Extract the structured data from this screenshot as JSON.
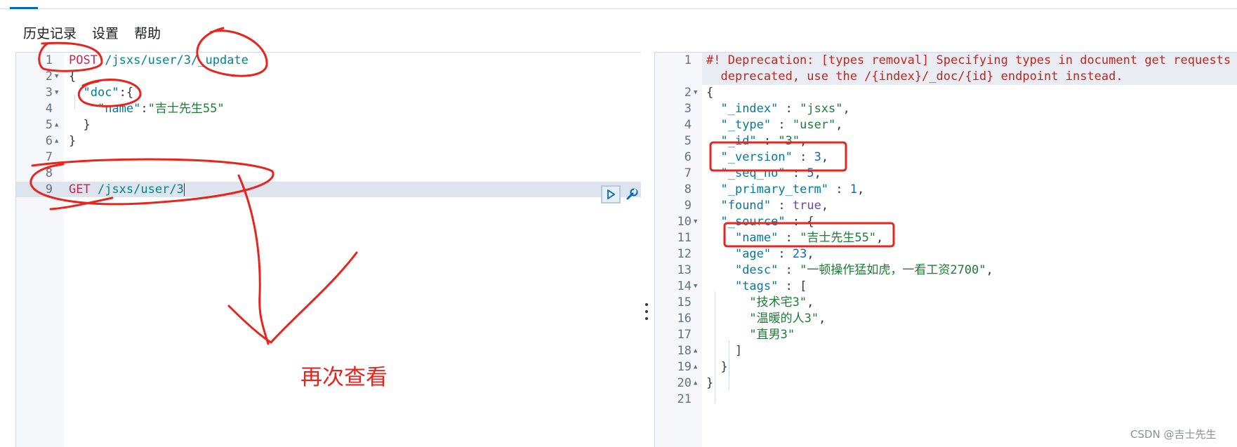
{
  "menu": {
    "history": "历史记录",
    "settings": "设置",
    "help": "帮助"
  },
  "request": {
    "lines": [
      {
        "n": "1",
        "fold": "",
        "parts": [
          [
            "method",
            "POST"
          ],
          [
            "punc",
            " "
          ],
          [
            "url",
            "/jsxs/user/3/_update"
          ]
        ]
      },
      {
        "n": "2",
        "fold": "down",
        "parts": [
          [
            "punc",
            "{"
          ]
        ]
      },
      {
        "n": "3",
        "fold": "down",
        "parts": [
          [
            "punc",
            "  "
          ],
          [
            "key",
            "\"doc\""
          ],
          [
            "punc",
            ":{"
          ]
        ]
      },
      {
        "n": "4",
        "fold": "",
        "parts": [
          [
            "punc",
            "    "
          ],
          [
            "key",
            "\"name\""
          ],
          [
            "punc",
            ":"
          ],
          [
            "str",
            "\"吉士先生55\""
          ]
        ]
      },
      {
        "n": "5",
        "fold": "up",
        "parts": [
          [
            "punc",
            "  }"
          ]
        ]
      },
      {
        "n": "6",
        "fold": "up",
        "parts": [
          [
            "punc",
            "}"
          ]
        ]
      },
      {
        "n": "7",
        "fold": "",
        "parts": []
      },
      {
        "n": "8",
        "fold": "",
        "parts": []
      },
      {
        "n": "9",
        "fold": "",
        "parts": [
          [
            "method",
            "GET"
          ],
          [
            "punc",
            " "
          ],
          [
            "url",
            "/jsxs/user/3"
          ]
        ]
      }
    ]
  },
  "response": {
    "lines": [
      {
        "n": "1",
        "fold": "",
        "parts": [
          [
            "comment",
            "#! Deprecation: [types removal] Specifying types in document get requests is"
          ]
        ]
      },
      {
        "n": "",
        "fold": "",
        "parts": [
          [
            "comment",
            "  deprecated, use the /{index}/_doc/{id} endpoint instead."
          ]
        ]
      },
      {
        "n": "2",
        "fold": "down",
        "parts": [
          [
            "punc",
            "{"
          ]
        ]
      },
      {
        "n": "3",
        "fold": "",
        "parts": [
          [
            "punc",
            "  "
          ],
          [
            "key",
            "\"_index\""
          ],
          [
            "punc",
            " : "
          ],
          [
            "str",
            "\"jsxs\""
          ],
          [
            "punc",
            ","
          ]
        ]
      },
      {
        "n": "4",
        "fold": "",
        "parts": [
          [
            "punc",
            "  "
          ],
          [
            "key",
            "\"_type\""
          ],
          [
            "punc",
            " : "
          ],
          [
            "str",
            "\"user\""
          ],
          [
            "punc",
            ","
          ]
        ]
      },
      {
        "n": "5",
        "fold": "",
        "parts": [
          [
            "punc",
            "  "
          ],
          [
            "key",
            "\"_id\""
          ],
          [
            "punc",
            " : "
          ],
          [
            "str",
            "\"3\""
          ],
          [
            "punc",
            ","
          ]
        ]
      },
      {
        "n": "6",
        "fold": "",
        "parts": [
          [
            "punc",
            "  "
          ],
          [
            "key",
            "\"_version\""
          ],
          [
            "punc",
            " : "
          ],
          [
            "num",
            "3"
          ],
          [
            "punc",
            ","
          ]
        ]
      },
      {
        "n": "7",
        "fold": "",
        "parts": [
          [
            "punc",
            "  "
          ],
          [
            "key",
            "\"_seq_no\""
          ],
          [
            "punc",
            " : "
          ],
          [
            "num",
            "5"
          ],
          [
            "punc",
            ","
          ]
        ]
      },
      {
        "n": "8",
        "fold": "",
        "parts": [
          [
            "punc",
            "  "
          ],
          [
            "key",
            "\"_primary_term\""
          ],
          [
            "punc",
            " : "
          ],
          [
            "num",
            "1"
          ],
          [
            "punc",
            ","
          ]
        ]
      },
      {
        "n": "9",
        "fold": "",
        "parts": [
          [
            "punc",
            "  "
          ],
          [
            "key",
            "\"found\""
          ],
          [
            "punc",
            " : "
          ],
          [
            "kw",
            "true"
          ],
          [
            "punc",
            ","
          ]
        ]
      },
      {
        "n": "10",
        "fold": "down",
        "parts": [
          [
            "punc",
            "  "
          ],
          [
            "key",
            "\"_source\""
          ],
          [
            "punc",
            " : {"
          ]
        ]
      },
      {
        "n": "11",
        "fold": "",
        "parts": [
          [
            "punc",
            "    "
          ],
          [
            "key",
            "\"name\""
          ],
          [
            "punc",
            " : "
          ],
          [
            "str",
            "\"吉士先生55\""
          ],
          [
            "punc",
            ","
          ]
        ]
      },
      {
        "n": "12",
        "fold": "",
        "parts": [
          [
            "punc",
            "    "
          ],
          [
            "key",
            "\"age\""
          ],
          [
            "punc",
            " : "
          ],
          [
            "num",
            "23"
          ],
          [
            "punc",
            ","
          ]
        ]
      },
      {
        "n": "13",
        "fold": "",
        "parts": [
          [
            "punc",
            "    "
          ],
          [
            "key",
            "\"desc\""
          ],
          [
            "punc",
            " : "
          ],
          [
            "str",
            "\"一顿操作猛如虎，一看工资2700\""
          ],
          [
            "punc",
            ","
          ]
        ]
      },
      {
        "n": "14",
        "fold": "down",
        "parts": [
          [
            "punc",
            "    "
          ],
          [
            "key",
            "\"tags\""
          ],
          [
            "punc",
            " : ["
          ]
        ]
      },
      {
        "n": "15",
        "fold": "",
        "parts": [
          [
            "punc",
            "      "
          ],
          [
            "str",
            "\"技术宅3\""
          ],
          [
            "punc",
            ","
          ]
        ]
      },
      {
        "n": "16",
        "fold": "",
        "parts": [
          [
            "punc",
            "      "
          ],
          [
            "str",
            "\"温暖的人3\""
          ],
          [
            "punc",
            ","
          ]
        ]
      },
      {
        "n": "17",
        "fold": "",
        "parts": [
          [
            "punc",
            "      "
          ],
          [
            "str",
            "\"直男3\""
          ]
        ]
      },
      {
        "n": "18",
        "fold": "up",
        "parts": [
          [
            "punc",
            "    ]"
          ]
        ]
      },
      {
        "n": "19",
        "fold": "up",
        "parts": [
          [
            "punc",
            "  }"
          ]
        ]
      },
      {
        "n": "20",
        "fold": "up",
        "parts": [
          [
            "punc",
            "}"
          ]
        ]
      },
      {
        "n": "21",
        "fold": "",
        "parts": []
      }
    ]
  },
  "annotation": {
    "text": "再次查看",
    "color": "#e8241d"
  },
  "watermark": "CSDN @吉士先生",
  "colors": {
    "accent": "#006bb4",
    "annotation_red": "#e8241d"
  },
  "icons": {
    "run": "play-icon",
    "settings": "wrench-icon"
  }
}
